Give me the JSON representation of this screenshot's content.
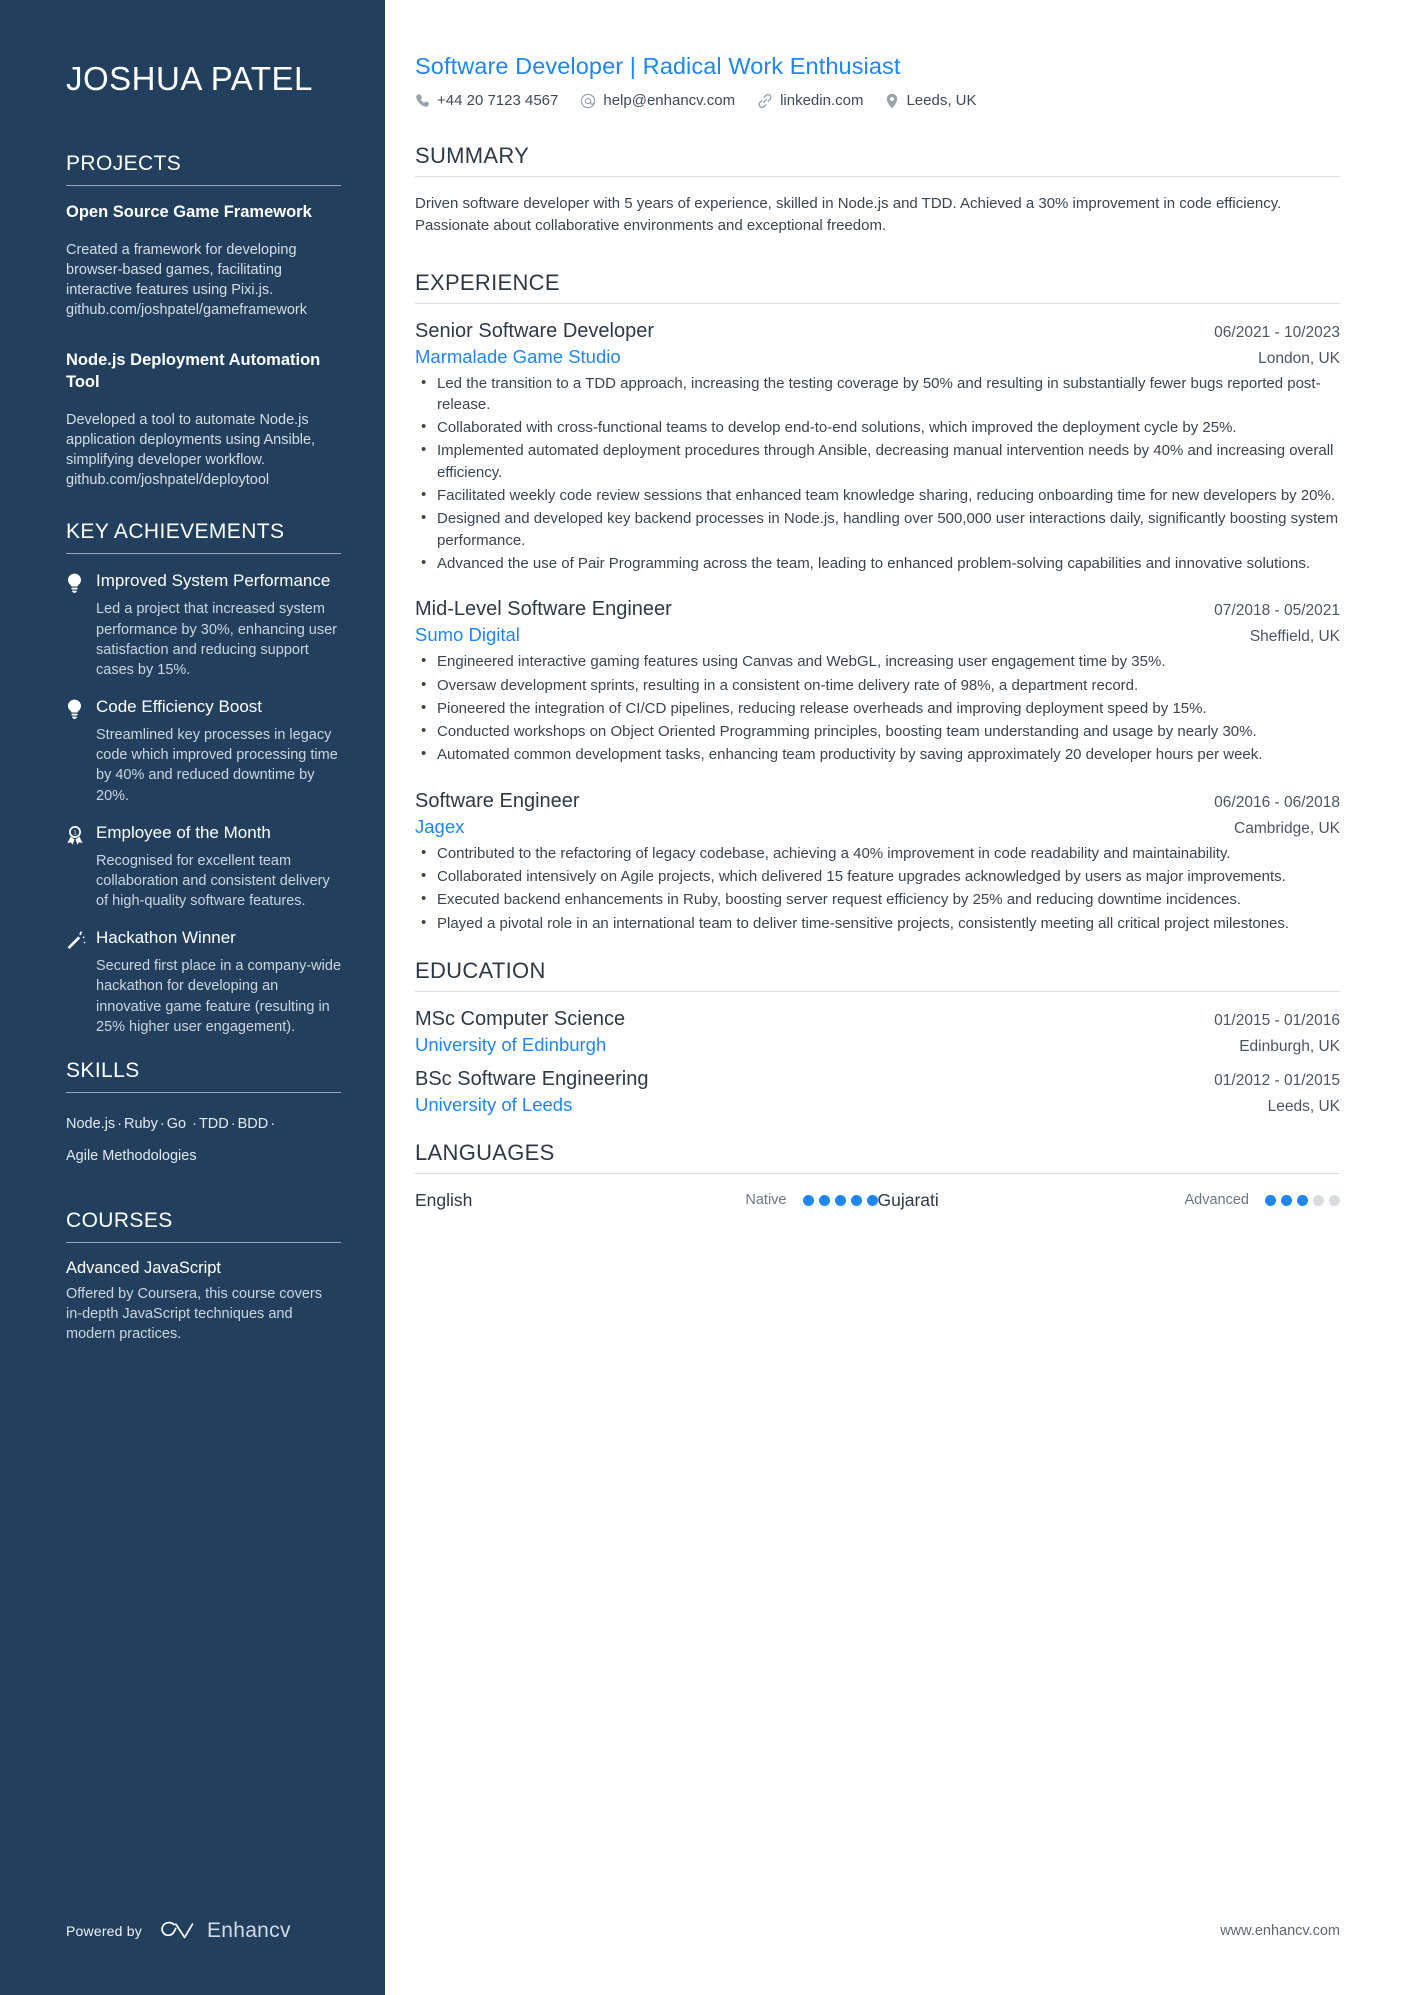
{
  "theme": {
    "sidebar_bg": "#22405d",
    "accent_blue": "#1f86f5",
    "text_dark": "#2d3a46"
  },
  "sidebar": {
    "name": "JOSHUA PATEL",
    "projects": {
      "heading": "PROJECTS",
      "items": [
        {
          "title": "Open Source Game Framework",
          "description": "Created a framework for developing browser-based games, facilitating interactive features using Pixi.js. github.com/joshpatel/gameframework"
        },
        {
          "title": "Node.js Deployment Automation Tool",
          "description": "Developed a tool to automate Node.js application deployments using Ansible, simplifying developer workflow. github.com/joshpatel/deploytool"
        }
      ]
    },
    "key_achievements": {
      "heading": "KEY ACHIEVEMENTS",
      "items": [
        {
          "icon": "lightbulb-icon",
          "title": "Improved System Performance",
          "description": "Led a project that increased system performance by 30%, enhancing user satisfaction and reducing support cases by 15%."
        },
        {
          "icon": "lightbulb-icon",
          "title": "Code Efficiency Boost",
          "description": "Streamlined key processes in legacy code which improved processing time by 40% and reduced downtime by 20%."
        },
        {
          "icon": "award-ribbon-icon",
          "title": "Employee of the Month",
          "description": "Recognised for excellent team collaboration and consistent delivery of high-quality software features."
        },
        {
          "icon": "magic-wand-icon",
          "title": "Hackathon Winner",
          "description": "Secured first place in a company-wide hackathon for developing an innovative game feature (resulting in 25% higher user engagement)."
        }
      ]
    },
    "skills": {
      "heading": "SKILLS",
      "items": [
        "Node.js",
        "Ruby",
        "Go",
        "TDD",
        "BDD",
        "Agile Methodologies"
      ],
      "separator": "·"
    },
    "courses": {
      "heading": "COURSES",
      "items": [
        {
          "title": "Advanced JavaScript",
          "description": "Offered by Coursera, this course covers in-depth JavaScript techniques and modern practices."
        }
      ]
    },
    "footer": {
      "powered_by": "Powered by",
      "brand": "Enhancv"
    }
  },
  "main": {
    "headline": "Software Developer | Radical Work Enthusiast",
    "contacts": [
      {
        "icon": "phone-icon",
        "value": "+44 20 7123 4567"
      },
      {
        "icon": "at-email-icon",
        "value": "help@enhancv.com"
      },
      {
        "icon": "link-chain-icon",
        "value": "linkedin.com"
      },
      {
        "icon": "location-pin-icon",
        "value": "Leeds, UK"
      }
    ],
    "summary": {
      "heading": "SUMMARY",
      "text": "Driven software developer with 5 years of experience, skilled in Node.js and TDD. Achieved a 30% improvement in code efficiency. Passionate about collaborative environments and exceptional freedom."
    },
    "experience": {
      "heading": "EXPERIENCE",
      "jobs": [
        {
          "title": "Senior Software Developer",
          "date": "06/2021 - 10/2023",
          "company": "Marmalade Game Studio",
          "location": "London, UK",
          "bullets": [
            "Led the transition to a TDD approach, increasing the testing coverage by 50% and resulting in substantially fewer bugs reported post-release.",
            "Collaborated with cross-functional teams to develop end-to-end solutions, which improved the deployment cycle by 25%.",
            "Implemented automated deployment procedures through Ansible, decreasing manual intervention needs by 40% and increasing overall efficiency.",
            "Facilitated weekly code review sessions that enhanced team knowledge sharing, reducing onboarding time for new developers by 20%.",
            "Designed and developed key backend processes in Node.js, handling over 500,000 user interactions daily, significantly boosting system performance.",
            "Advanced the use of Pair Programming across the team, leading to enhanced problem-solving capabilities and innovative solutions."
          ]
        },
        {
          "title": "Mid-Level Software Engineer",
          "date": "07/2018 - 05/2021",
          "company": "Sumo Digital",
          "location": "Sheffield, UK",
          "bullets": [
            "Engineered interactive gaming features using Canvas and WebGL, increasing user engagement time by 35%.",
            "Oversaw development sprints, resulting in a consistent on-time delivery rate of 98%, a department record.",
            "Pioneered the integration of CI/CD pipelines, reducing release overheads and improving deployment speed by 15%.",
            "Conducted workshops on Object Oriented Programming principles, boosting team understanding and usage by nearly 30%.",
            "Automated common development tasks, enhancing team productivity by saving approximately 20 developer hours per week."
          ]
        },
        {
          "title": "Software Engineer",
          "date": "06/2016 - 06/2018",
          "company": "Jagex",
          "location": "Cambridge, UK",
          "bullets": [
            "Contributed to the refactoring of legacy codebase, achieving a 40% improvement in code readability and maintainability.",
            "Collaborated intensively on Agile projects, which delivered 15 feature upgrades acknowledged by users as major improvements.",
            "Executed backend enhancements in Ruby, boosting server request efficiency by 25% and reducing downtime incidences.",
            "Played a pivotal role in an international team to deliver time-sensitive projects, consistently meeting all critical project milestones."
          ]
        }
      ]
    },
    "education": {
      "heading": "EDUCATION",
      "items": [
        {
          "degree": "MSc Computer Science",
          "date": "01/2015 - 01/2016",
          "school": "University of Edinburgh",
          "location": "Edinburgh, UK"
        },
        {
          "degree": "BSc Software Engineering",
          "date": "01/2012 - 01/2015",
          "school": "University of Leeds",
          "location": "Leeds, UK"
        }
      ]
    },
    "languages": {
      "heading": "LANGUAGES",
      "items": [
        {
          "name": "English",
          "level": "Native",
          "filled": 5,
          "total": 5
        },
        {
          "name": "Gujarati",
          "level": "Advanced",
          "filled": 3,
          "total": 5
        }
      ]
    },
    "footer_url": "www.enhancv.com"
  }
}
